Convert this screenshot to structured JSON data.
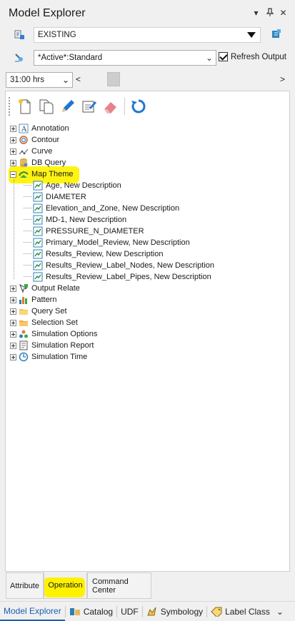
{
  "window": {
    "title": "Model Explorer",
    "controls": {
      "menu": "▾",
      "pin": "⊣",
      "close": "✕"
    }
  },
  "scenario": {
    "value": "EXISTING"
  },
  "alternative": {
    "value": "*Active*:Standard",
    "refresh_label": "Refresh Output",
    "refresh_checked": true
  },
  "time": {
    "value": "31:00 hrs"
  },
  "toolbar": {
    "icons": [
      "new-icon",
      "copy-icon",
      "edit-pencil-icon",
      "rename-icon",
      "delete-eraser-icon",
      "refresh-icon"
    ]
  },
  "tree": {
    "nodes": [
      {
        "label": "Annotation",
        "icon": "annotation-icon",
        "expanded": false
      },
      {
        "label": "Contour",
        "icon": "contour-icon",
        "expanded": false
      },
      {
        "label": "Curve",
        "icon": "curve-icon",
        "expanded": false
      },
      {
        "label": "DB Query",
        "icon": "db-query-icon",
        "expanded": false
      },
      {
        "label": "Map Theme",
        "icon": "map-theme-icon",
        "expanded": true
      },
      {
        "label": "Output Relate",
        "icon": "output-relate-icon",
        "expanded": false
      },
      {
        "label": "Pattern",
        "icon": "pattern-icon",
        "expanded": false
      },
      {
        "label": "Query Set",
        "icon": "query-set-icon",
        "expanded": false
      },
      {
        "label": "Selection Set",
        "icon": "selection-set-icon",
        "expanded": false
      },
      {
        "label": "Simulation Options",
        "icon": "simulation-options-icon",
        "expanded": false
      },
      {
        "label": "Simulation Report",
        "icon": "simulation-report-icon",
        "expanded": false
      },
      {
        "label": "Simulation Time",
        "icon": "simulation-time-icon",
        "expanded": false
      }
    ],
    "map_theme_children": [
      "Age, New Description",
      "DIAMETER",
      "Elevation_and_Zone, New Description",
      "MD-1, New Description",
      "PRESSURE_N_DIAMETER",
      "Primary_Model_Review, New Description",
      "Results_Review, New Description",
      "Results_Review_Label_Nodes, New Description",
      "Results_Review_Label_Pipes, New Description"
    ]
  },
  "tabs": [
    {
      "label": "Attribute"
    },
    {
      "label": "Operation",
      "active": true
    },
    {
      "label": "Command Center"
    }
  ],
  "dock": [
    {
      "label": "Model Explorer",
      "active": true
    },
    {
      "label": "Catalog",
      "icon": "catalog-icon"
    },
    {
      "label": "UDF"
    },
    {
      "label": "Symbology",
      "icon": "symbology-icon"
    },
    {
      "label": "Label Class",
      "icon": "label-class-icon"
    }
  ],
  "colors": {
    "highlight": "#fff200",
    "accent": "#1a5fb4",
    "theme_icon": "#2e8b3d"
  }
}
